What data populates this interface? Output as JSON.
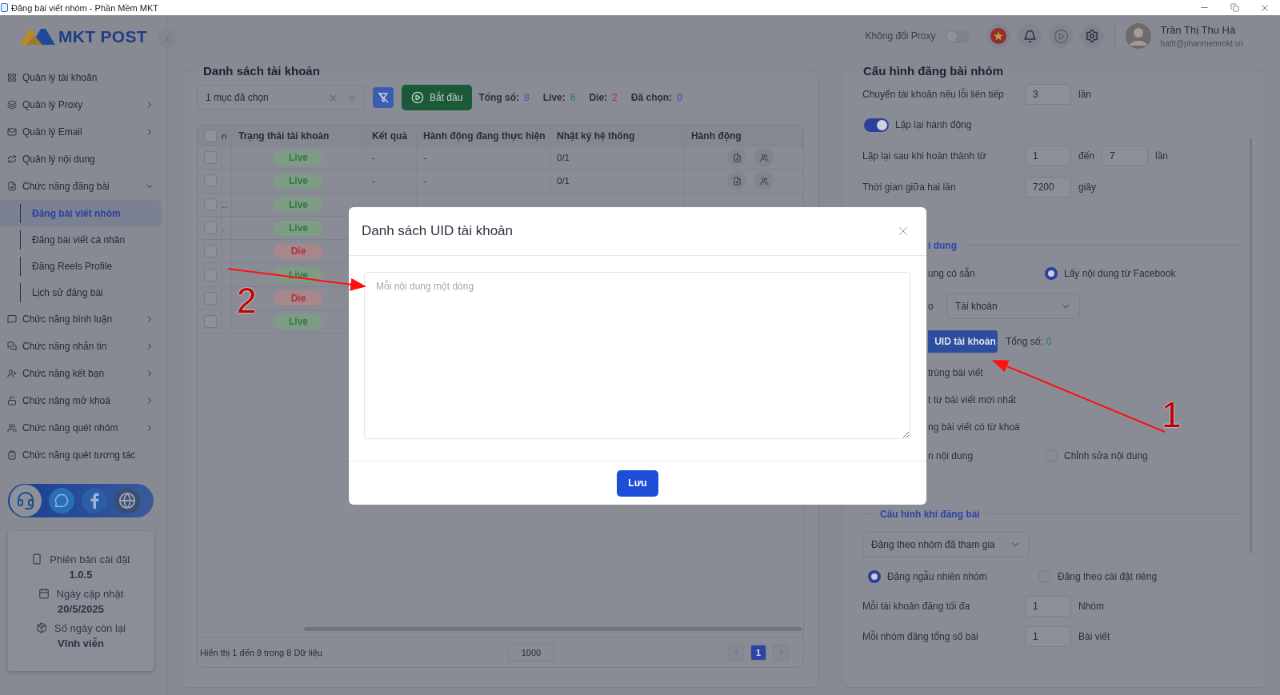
{
  "window": {
    "title": "Đăng bài viết nhóm - Phần Mềm MKT"
  },
  "sidebar": {
    "logo": "MKT POST",
    "items": [
      {
        "kind": "link",
        "label": "Quản lý tài khoản"
      },
      {
        "kind": "group",
        "label": "Quản lý Proxy",
        "expanded": false
      },
      {
        "kind": "group",
        "label": "Quản lý Email",
        "expanded": false
      },
      {
        "kind": "link",
        "label": "Quản lý nội dung"
      },
      {
        "kind": "group",
        "label": "Chức năng đăng bài",
        "expanded": true,
        "children": [
          {
            "label": "Đăng bài viết nhóm",
            "selected": true
          },
          {
            "label": "Đăng bài viết cá nhân",
            "selected": false
          },
          {
            "label": "Đăng Reels Profile",
            "selected": false
          },
          {
            "label": "Lịch sử đăng bài",
            "selected": false
          }
        ]
      },
      {
        "kind": "group",
        "label": "Chức năng bình luận",
        "expanded": false
      },
      {
        "kind": "group",
        "label": "Chức năng nhắn tin",
        "expanded": false
      },
      {
        "kind": "group",
        "label": "Chức năng kết bạn",
        "expanded": false
      },
      {
        "kind": "group",
        "label": "Chức năng mở khoá",
        "expanded": false
      },
      {
        "kind": "group",
        "label": "Chức năng quét nhóm",
        "expanded": false
      },
      {
        "kind": "link",
        "label": "Chức năng quét tương tác"
      }
    ],
    "info": [
      {
        "label": "Phiên bản cài đặt",
        "value": "1.0.5"
      },
      {
        "label": "Ngày cập nhật",
        "value": "20/5/2025"
      },
      {
        "label": "Số ngày còn lại",
        "value": "Vĩnh viễn"
      }
    ]
  },
  "header": {
    "proxy_label": "Không đổi Proxy",
    "proxy_on": false,
    "user": {
      "name": "Trần Thị Thu Hà",
      "email": "hattt@phanmemmkt.vn"
    }
  },
  "accounts": {
    "title": "Danh sách tài khoản",
    "all_checked": false,
    "filter": "1 mục đã chọn",
    "start_button": "Bắt đầu",
    "stats": [
      {
        "label": "Tổng số:",
        "value": "8",
        "color": "#3f56a8"
      },
      {
        "label": "Live:",
        "value": "6",
        "color": "#2e7a4e"
      },
      {
        "label": "Die:",
        "value": "2",
        "color": "#b0333b"
      },
      {
        "label": "Đã chọn:",
        "value": "0",
        "color": "#3148b0"
      }
    ],
    "columns": [
      "n",
      "Trạng thái tài khoản",
      "Kết quả",
      "Hành động đang thực hiện",
      "Nhật ký hệ thống",
      "Hành động"
    ],
    "rows": [
      {
        "checked": false,
        "status": {
          "kind": "live",
          "label": "Live"
        },
        "result": "-",
        "current_action": "-",
        "log": "0/1",
        "actions": true
      },
      {
        "checked": false,
        "status": {
          "kind": "live",
          "label": "Live"
        },
        "result": "-",
        "current_action": "-",
        "log": "0/1",
        "actions": true
      },
      {
        "checked": false,
        "column_1": "..",
        "status": {
          "kind": "live",
          "label": "Live"
        }
      },
      {
        "checked": false,
        "column_1": ".",
        "status": {
          "kind": "live",
          "label": "Live"
        }
      },
      {
        "checked": false,
        "status": {
          "kind": "die",
          "label": "Die"
        }
      },
      {
        "checked": false,
        "status": {
          "kind": "live",
          "label": "Live"
        }
      },
      {
        "checked": false,
        "status": {
          "kind": "die",
          "label": "Die"
        }
      },
      {
        "checked": false,
        "status": {
          "kind": "live",
          "label": "Live"
        }
      }
    ],
    "footer": {
      "summary": "Hiển thị 1 đến 8 trong 8 Dữ liệu",
      "page_size": "1000",
      "pages": [
        {
          "label": "1",
          "selected": true
        }
      ]
    }
  },
  "config": {
    "title": "Cấu hình đăng bài nhóm",
    "rows": [
      {
        "kind": "number",
        "label": "Chuyển tài khoản nếu lỗi liên tiếp",
        "value": "3",
        "unit": "lần"
      },
      {
        "kind": "toggle",
        "label": "Lặp lại hành động",
        "on": true
      },
      {
        "kind": "range",
        "label": "Lặp lại sau khi hoàn thành từ",
        "from": "1",
        "joiner": "đến",
        "to": "7",
        "unit": "lần"
      },
      {
        "kind": "number",
        "label": "Thời gian giữa hai lần",
        "value": "7200",
        "unit": "giây"
      },
      {
        "kind": "section",
        "cut_text": "i dung"
      },
      {
        "kind": "radios",
        "cut_text": "ung có sẵn",
        "option": {
          "label": "Lấy nội dung từ Facebook",
          "selected": true
        }
      },
      {
        "kind": "select",
        "cut_text": "o",
        "value": "Tài khoản"
      },
      {
        "kind": "button",
        "label": "UID tài khoản",
        "total_label": "Tổng số:",
        "total": "0"
      },
      {
        "kind": "text",
        "cut_text": "trùng bài viết"
      },
      {
        "kind": "text",
        "cut_text": "t từ bài viết mới nhất"
      },
      {
        "kind": "text",
        "cut_text": "ng bài viết có từ khoá"
      },
      {
        "kind": "radios",
        "cut_text": "n nội dung",
        "option": {
          "label": "Chỉnh sửa nội dung",
          "selected": false
        }
      },
      {
        "kind": "section",
        "label": "Cấu hình khi đăng bài"
      },
      {
        "kind": "select",
        "value": "Đăng theo nhóm đã tham gia"
      },
      {
        "kind": "radio_pair",
        "options": [
          {
            "label": "Đăng ngẫu nhiên nhóm",
            "selected": true
          },
          {
            "label": "Đăng theo cài đặt riêng",
            "selected": false
          }
        ]
      },
      {
        "kind": "number",
        "label": "Mỗi tài khoản đăng tối đa",
        "value": "1",
        "unit": "Nhóm"
      },
      {
        "kind": "number",
        "label": "Mỗi nhóm đăng tổng số bài",
        "value": "1",
        "unit": "Bài viết"
      }
    ]
  },
  "modal": {
    "title": "Danh sách UID tài khoản",
    "placeholder": "Mỗi nội dung một dòng",
    "save_button": "Lưu"
  },
  "annotations": [
    {
      "label": "1"
    },
    {
      "label": "2"
    }
  ]
}
